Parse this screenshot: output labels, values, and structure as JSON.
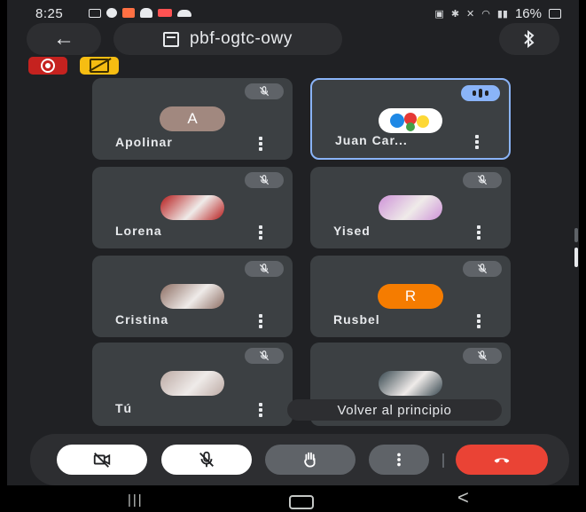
{
  "status_bar": {
    "time": "8:25",
    "battery": "16%"
  },
  "header": {
    "back_label": "←",
    "meeting_code": "pbf-ogtc-owy",
    "bluetooth_icon": "bluetooth-icon"
  },
  "badges": {
    "recording": "recording-icon",
    "captions": "captions-off-icon"
  },
  "participants": [
    {
      "name": "Apolinar",
      "initial": "A",
      "avatar_color": "#a1887f",
      "muted": true,
      "speaking": false
    },
    {
      "name": "Juan Car...",
      "initial": "",
      "avatar_color": "#ffffff",
      "muted": false,
      "speaking": true
    },
    {
      "name": "Lorena",
      "initial": "",
      "avatar_color": "#b71c1c",
      "muted": true,
      "speaking": false
    },
    {
      "name": "Yised",
      "initial": "",
      "avatar_color": "#ce93d8",
      "muted": true,
      "speaking": false
    },
    {
      "name": "Cristina",
      "initial": "",
      "avatar_color": "#8d6e63",
      "muted": true,
      "speaking": false
    },
    {
      "name": "Rusbel",
      "initial": "R",
      "avatar_color": "#f57c00",
      "muted": true,
      "speaking": false
    },
    {
      "name": "Tú",
      "initial": "",
      "avatar_color": "#bcaaa4",
      "muted": true,
      "speaking": false
    },
    {
      "name": "",
      "initial": "",
      "avatar_color": "#37474f",
      "muted": true,
      "speaking": false
    }
  ],
  "tooltip": {
    "text": "Volver al principio"
  },
  "controls": {
    "camera": "camera-off-icon",
    "mic": "mic-off-icon",
    "hand": "raise-hand-icon",
    "more": "more-icon",
    "end": "end-call-icon"
  },
  "colors": {
    "accent": "#8ab4f8",
    "end_call": "#ea4335",
    "background": "#202124",
    "tile": "#3c4043"
  }
}
